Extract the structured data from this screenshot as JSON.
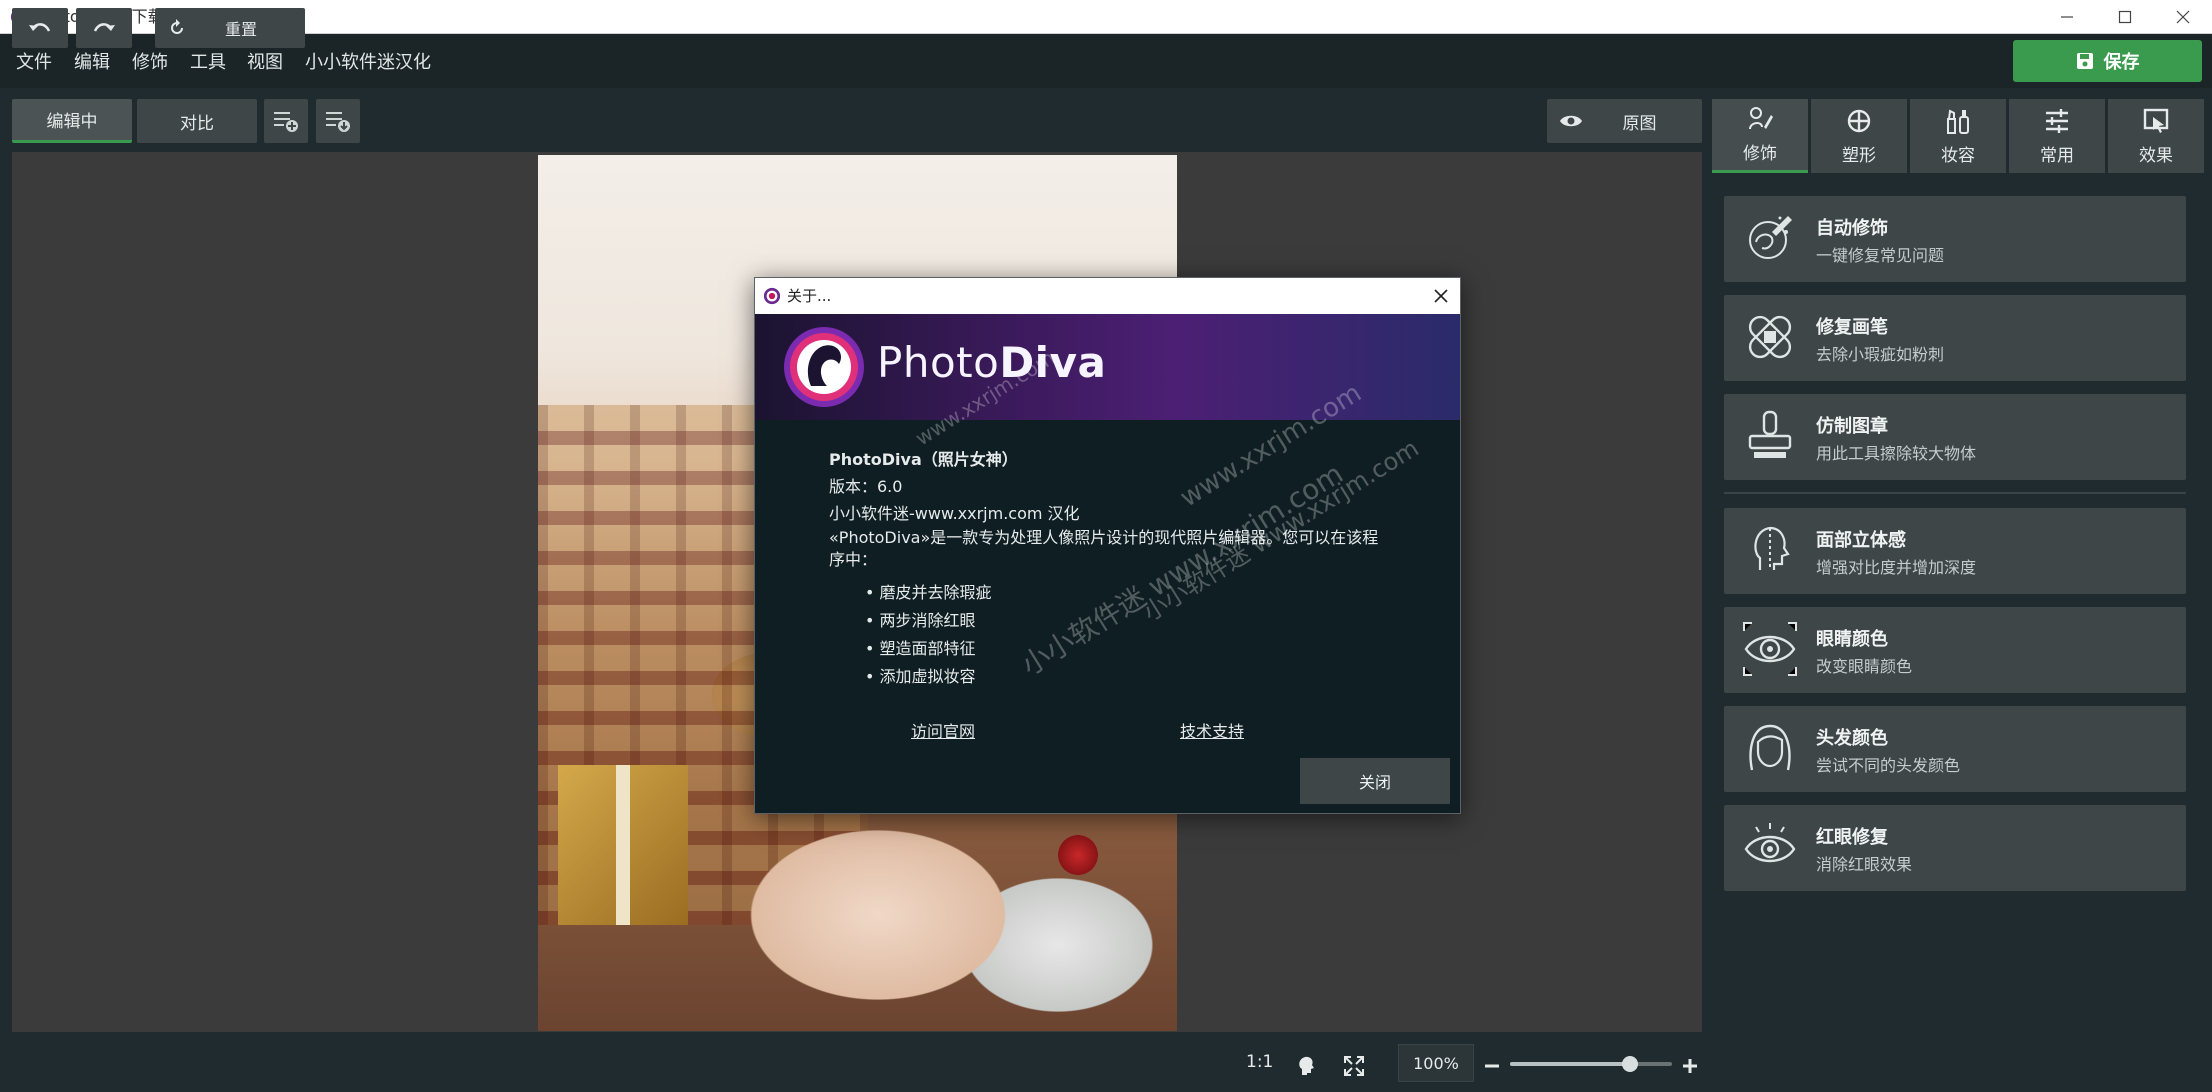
{
  "window": {
    "title": "PhotoDiva - 下载.jpg"
  },
  "menu": {
    "items": [
      "文件",
      "编辑",
      "修饰",
      "工具",
      "视图",
      "小小软件迷汉化"
    ],
    "save_label": "保存"
  },
  "toolbar": {
    "editing_label": "编辑中",
    "compare_label": "对比",
    "original_label": "原图"
  },
  "bottom": {
    "reset_label": "重置",
    "ratio_label": "1:1",
    "zoom_value": "100%",
    "zoom_level": 0.74
  },
  "right_tabs": [
    {
      "label": "修饰",
      "icon": "retouch-icon"
    },
    {
      "label": "塑形",
      "icon": "shape-icon"
    },
    {
      "label": "妆容",
      "icon": "makeup-icon"
    },
    {
      "label": "常用",
      "icon": "sliders-icon"
    },
    {
      "label": "效果",
      "icon": "effects-icon"
    }
  ],
  "tools": [
    {
      "name": "自动修饰",
      "desc": "一键修复常见问题",
      "icon": "auto-retouch-icon"
    },
    {
      "name": "修复画笔",
      "desc": "去除小瑕疵如粉刺",
      "icon": "bandage-icon"
    },
    {
      "name": "仿制图章",
      "desc": "用此工具擦除较大物体",
      "icon": "stamp-icon"
    },
    {
      "name": "面部立体感",
      "desc": "增强对比度并增加深度",
      "icon": "face-contour-icon"
    },
    {
      "name": "眼睛颜色",
      "desc": "改变眼睛颜色",
      "icon": "eye-color-icon"
    },
    {
      "name": "头发颜色",
      "desc": "尝试不同的头发颜色",
      "icon": "hair-icon"
    },
    {
      "name": "红眼修复",
      "desc": "消除红眼效果",
      "icon": "red-eye-icon"
    }
  ],
  "about": {
    "title": "关于...",
    "brand_light": "Photo",
    "brand_bold": "Diva",
    "product": "PhotoDiva（照片女神）",
    "version": "版本：6.0",
    "localized": "小小软件迷-www.xxrjm.com 汉化",
    "description": "«PhotoDiva»是一款专为处理人像照片设计的现代照片编辑器。您可以在该程序中：",
    "features": [
      "• 磨皮并去除瑕疵",
      "• 两步消除红眼",
      "• 塑造面部特征",
      "• 添加虚拟妆容"
    ],
    "link_site": "访问官网",
    "link_support": "技术支持",
    "close_label": "关闭",
    "watermarks": [
      "www.xxrjm.com",
      "小小软件迷 www.xxrjm.com",
      "小小软件迷 www.xxrjm.com",
      "www.xxrjm.com"
    ]
  },
  "colors": {
    "accent": "#3a9a4d",
    "panel": "#3e4648",
    "background": "#1f2b2e",
    "dialog": "#0f1e23"
  }
}
